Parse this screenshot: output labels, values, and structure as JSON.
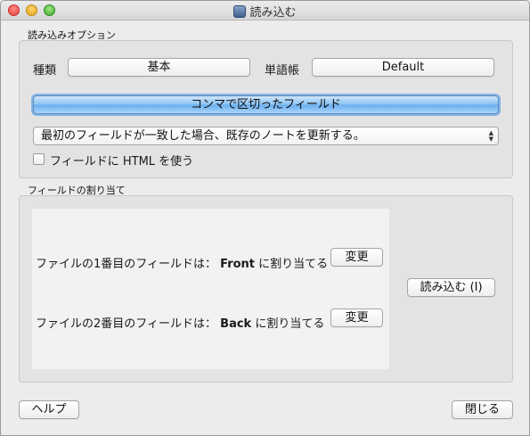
{
  "window": {
    "title": "読み込む",
    "title_icon": "import-app-icon"
  },
  "options": {
    "section_label": "読み込みオプション",
    "type_label": "種類",
    "type_value": "基本",
    "deck_label": "単語帳",
    "deck_value": "Default",
    "delimiter_button": "コンマで区切ったフィールド",
    "update_mode_selected": "最初のフィールドが一致した場合、既存のノートを更新する。",
    "allow_html_label": "フィールドに HTML を使う",
    "allow_html_checked": false
  },
  "mapping": {
    "section_label": "フィールドの割り当て",
    "rows": [
      {
        "prefix": "ファイルの1番目のフィールドは：",
        "field": "Front",
        "suffix": "に割り当てる",
        "change_label": "変更"
      },
      {
        "prefix": "ファイルの2番目のフィールドは：",
        "field": "Back",
        "suffix": "に割り当てる",
        "change_label": "変更"
      }
    ],
    "import_button": "読み込む (I)"
  },
  "footer": {
    "help_button": "ヘルプ",
    "close_button": "閉じる"
  }
}
